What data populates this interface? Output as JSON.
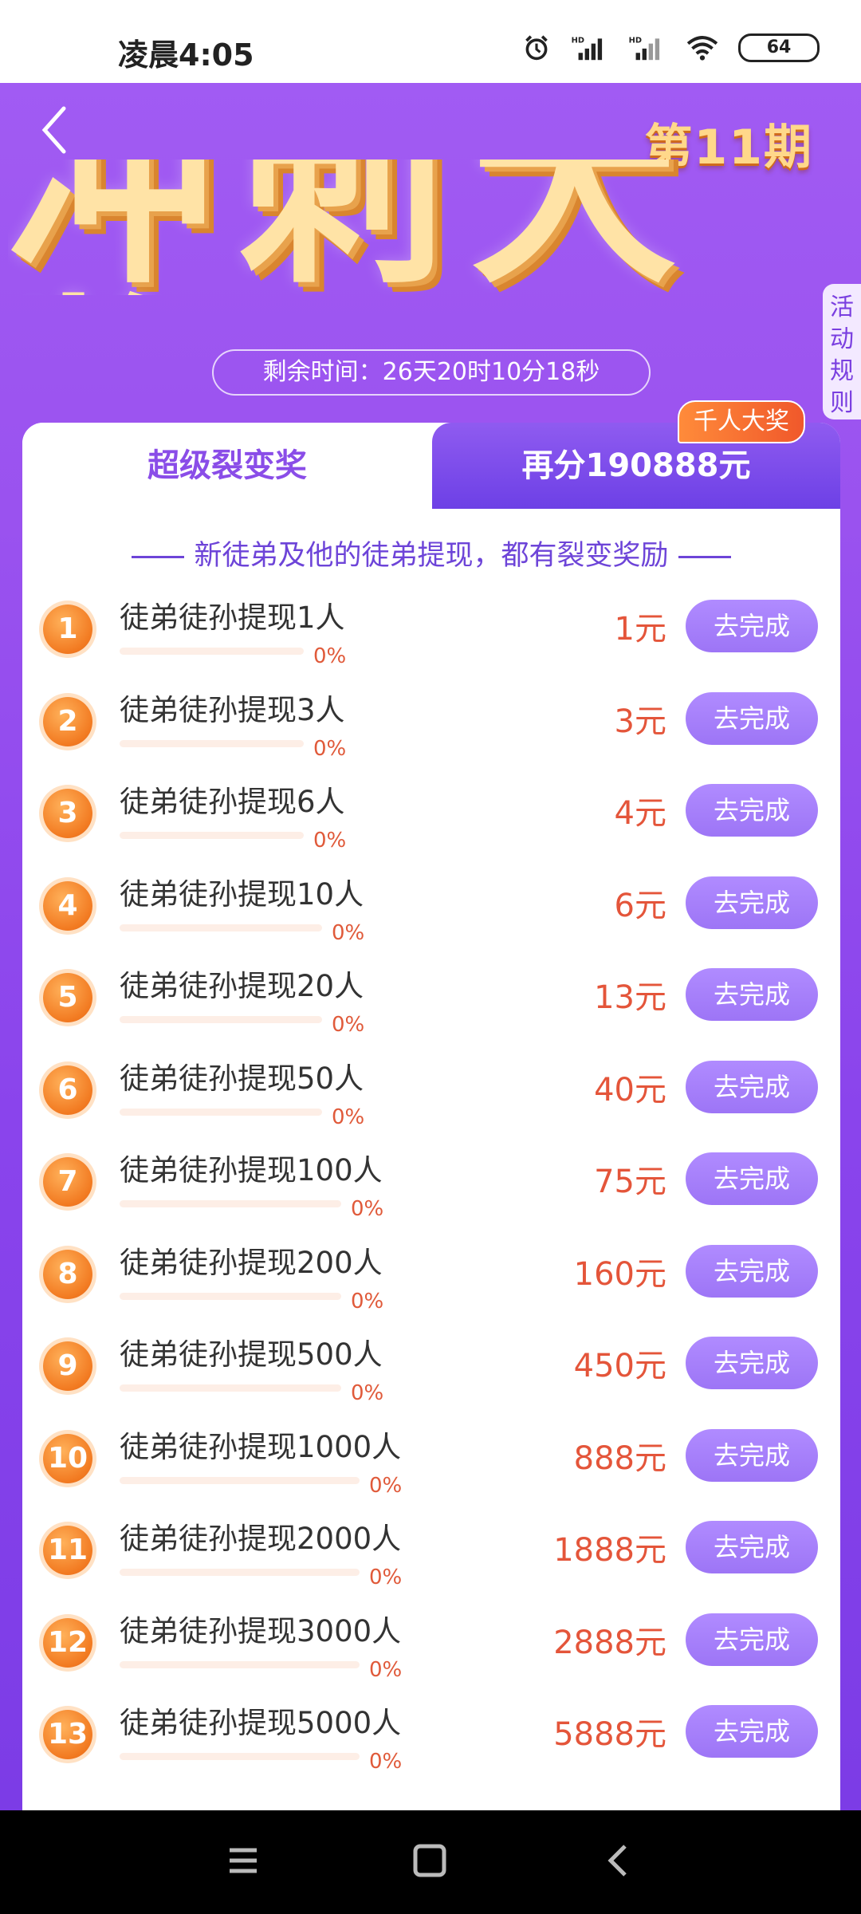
{
  "status_bar": {
    "time": "凌晨4:05",
    "battery": "64"
  },
  "header": {
    "issue": "第11期",
    "banner_title": "冲刺大奖",
    "rules_tab": "活动规则",
    "timer": "剩余时间：26天20时10分18秒"
  },
  "tabs": {
    "left_label": "超级裂变奖",
    "right_label": "再分190888元",
    "right_badge": "千人大奖"
  },
  "subtitle": "新徒弟及他的徒弟提现，都有裂变奖励",
  "tasks": [
    {
      "num": "1",
      "title": "徒弟徒孙提现1人",
      "progress": "0%",
      "reward": "1元",
      "button": "去完成"
    },
    {
      "num": "2",
      "title": "徒弟徒孙提现3人",
      "progress": "0%",
      "reward": "3元",
      "button": "去完成"
    },
    {
      "num": "3",
      "title": "徒弟徒孙提现6人",
      "progress": "0%",
      "reward": "4元",
      "button": "去完成"
    },
    {
      "num": "4",
      "title": "徒弟徒孙提现10人",
      "progress": "0%",
      "reward": "6元",
      "button": "去完成"
    },
    {
      "num": "5",
      "title": "徒弟徒孙提现20人",
      "progress": "0%",
      "reward": "13元",
      "button": "去完成"
    },
    {
      "num": "6",
      "title": "徒弟徒孙提现50人",
      "progress": "0%",
      "reward": "40元",
      "button": "去完成"
    },
    {
      "num": "7",
      "title": "徒弟徒孙提现100人",
      "progress": "0%",
      "reward": "75元",
      "button": "去完成"
    },
    {
      "num": "8",
      "title": "徒弟徒孙提现200人",
      "progress": "0%",
      "reward": "160元",
      "button": "去完成"
    },
    {
      "num": "9",
      "title": "徒弟徒孙提现500人",
      "progress": "0%",
      "reward": "450元",
      "button": "去完成"
    },
    {
      "num": "10",
      "title": "徒弟徒孙提现1000人",
      "progress": "0%",
      "reward": "888元",
      "button": "去完成"
    },
    {
      "num": "11",
      "title": "徒弟徒孙提现2000人",
      "progress": "0%",
      "reward": "1888元",
      "button": "去完成"
    },
    {
      "num": "12",
      "title": "徒弟徒孙提现3000人",
      "progress": "0%",
      "reward": "2888元",
      "button": "去完成"
    },
    {
      "num": "13",
      "title": "徒弟徒孙提现5000人",
      "progress": "0%",
      "reward": "5888元",
      "button": "去完成"
    }
  ],
  "icons": {
    "back": "chevron-left-icon",
    "alarm": "alarm-icon",
    "signal": "signal-icon",
    "wifi": "wifi-icon",
    "battery": "battery-icon",
    "nav_menu": "menu-icon",
    "nav_home": "home-icon",
    "nav_back": "back-icon"
  },
  "colors": {
    "accent_purple": "#9a52ef",
    "reward_red": "#e4553a",
    "badge_orange": "#f0582b",
    "button_purple": "#a57ffa"
  }
}
